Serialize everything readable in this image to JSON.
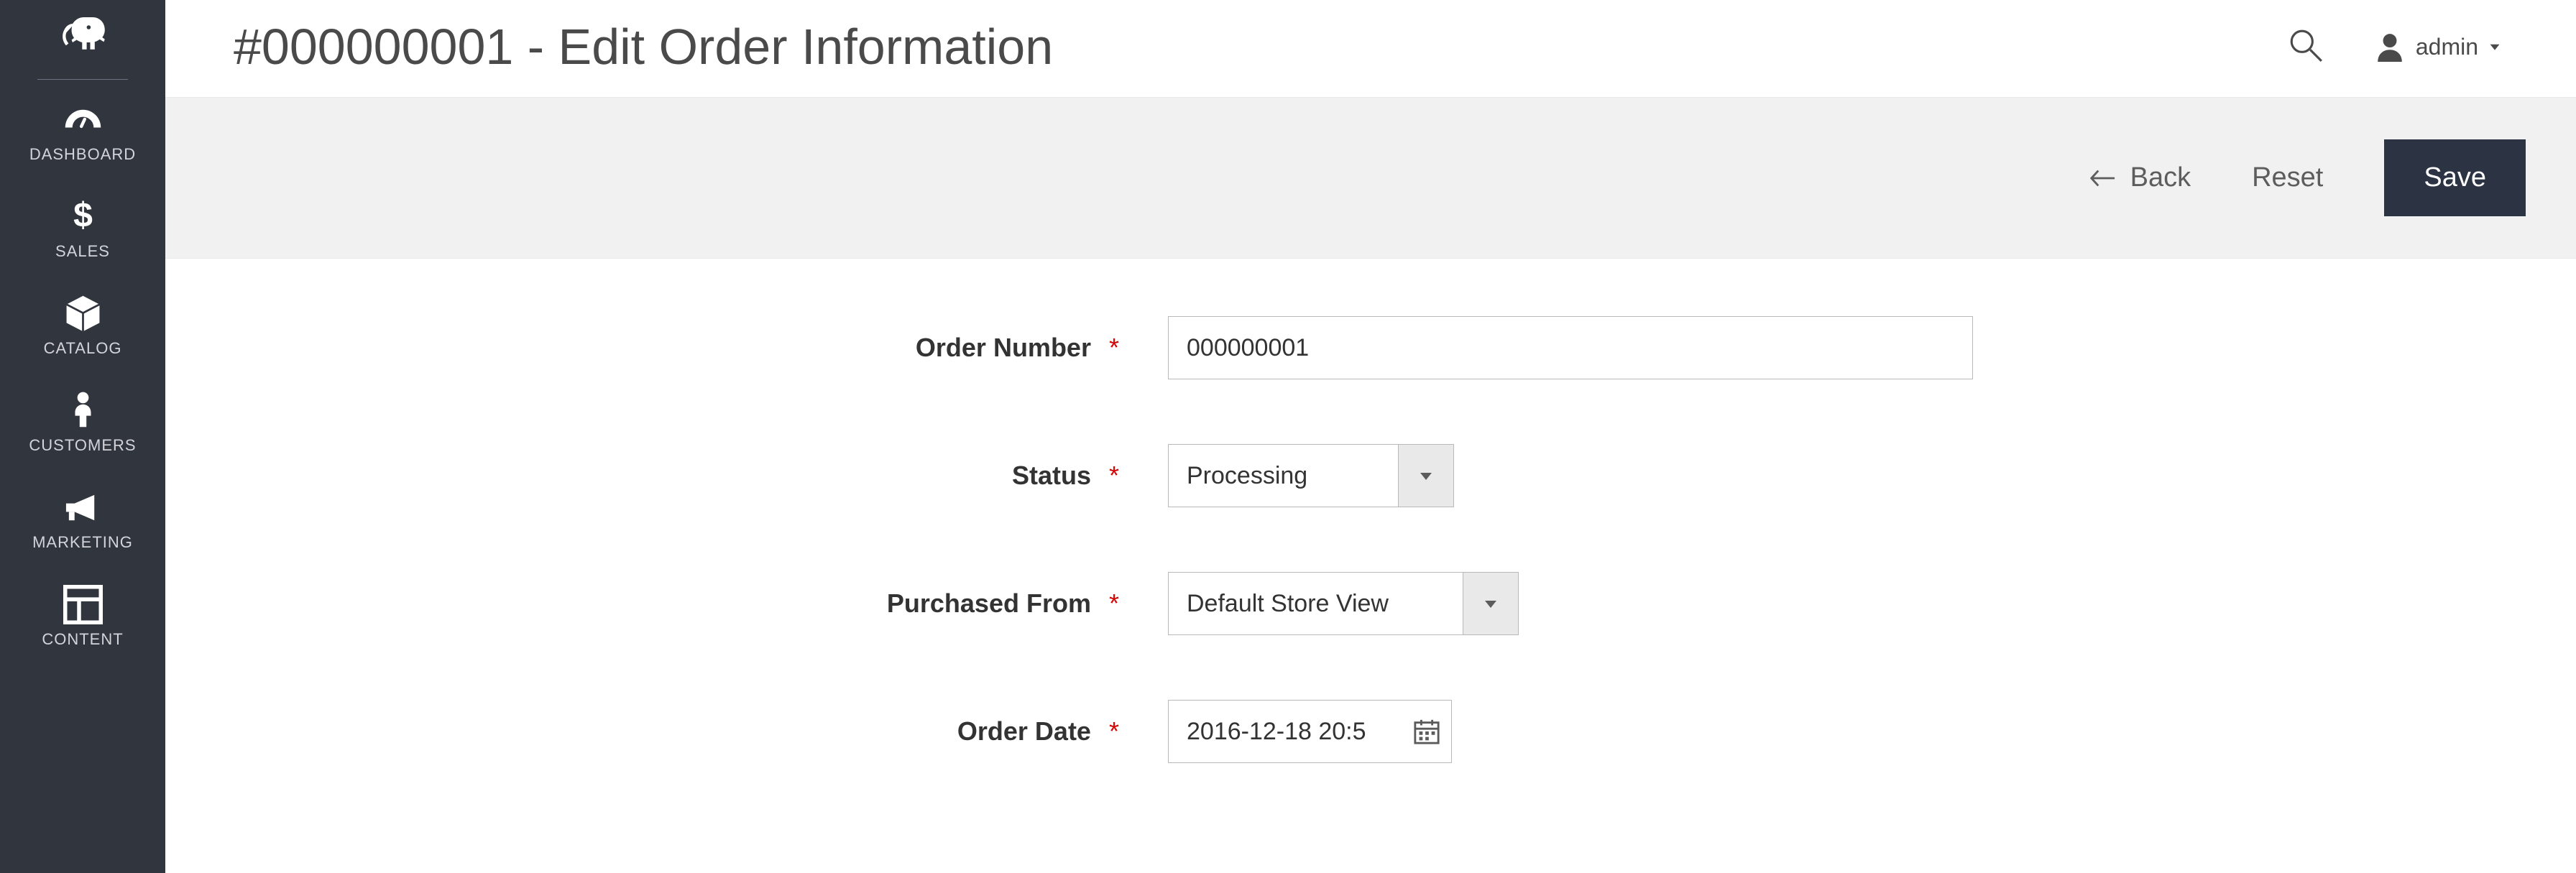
{
  "sidebar": {
    "items": [
      {
        "label": "DASHBOARD"
      },
      {
        "label": "SALES"
      },
      {
        "label": "CATALOG"
      },
      {
        "label": "CUSTOMERS"
      },
      {
        "label": "MARKETING"
      },
      {
        "label": "CONTENT"
      }
    ]
  },
  "header": {
    "title": "#000000001 - Edit Order Information",
    "user": "admin"
  },
  "toolbar": {
    "back_label": "Back",
    "reset_label": "Reset",
    "save_label": "Save"
  },
  "form": {
    "order_number": {
      "label": "Order Number",
      "value": "000000001"
    },
    "status": {
      "label": "Status",
      "value": "Processing"
    },
    "purchased_from": {
      "label": "Purchased From",
      "value": "Default Store View"
    },
    "order_date": {
      "label": "Order Date",
      "value": "2016-12-18 20:5"
    }
  },
  "required_marker": "*"
}
